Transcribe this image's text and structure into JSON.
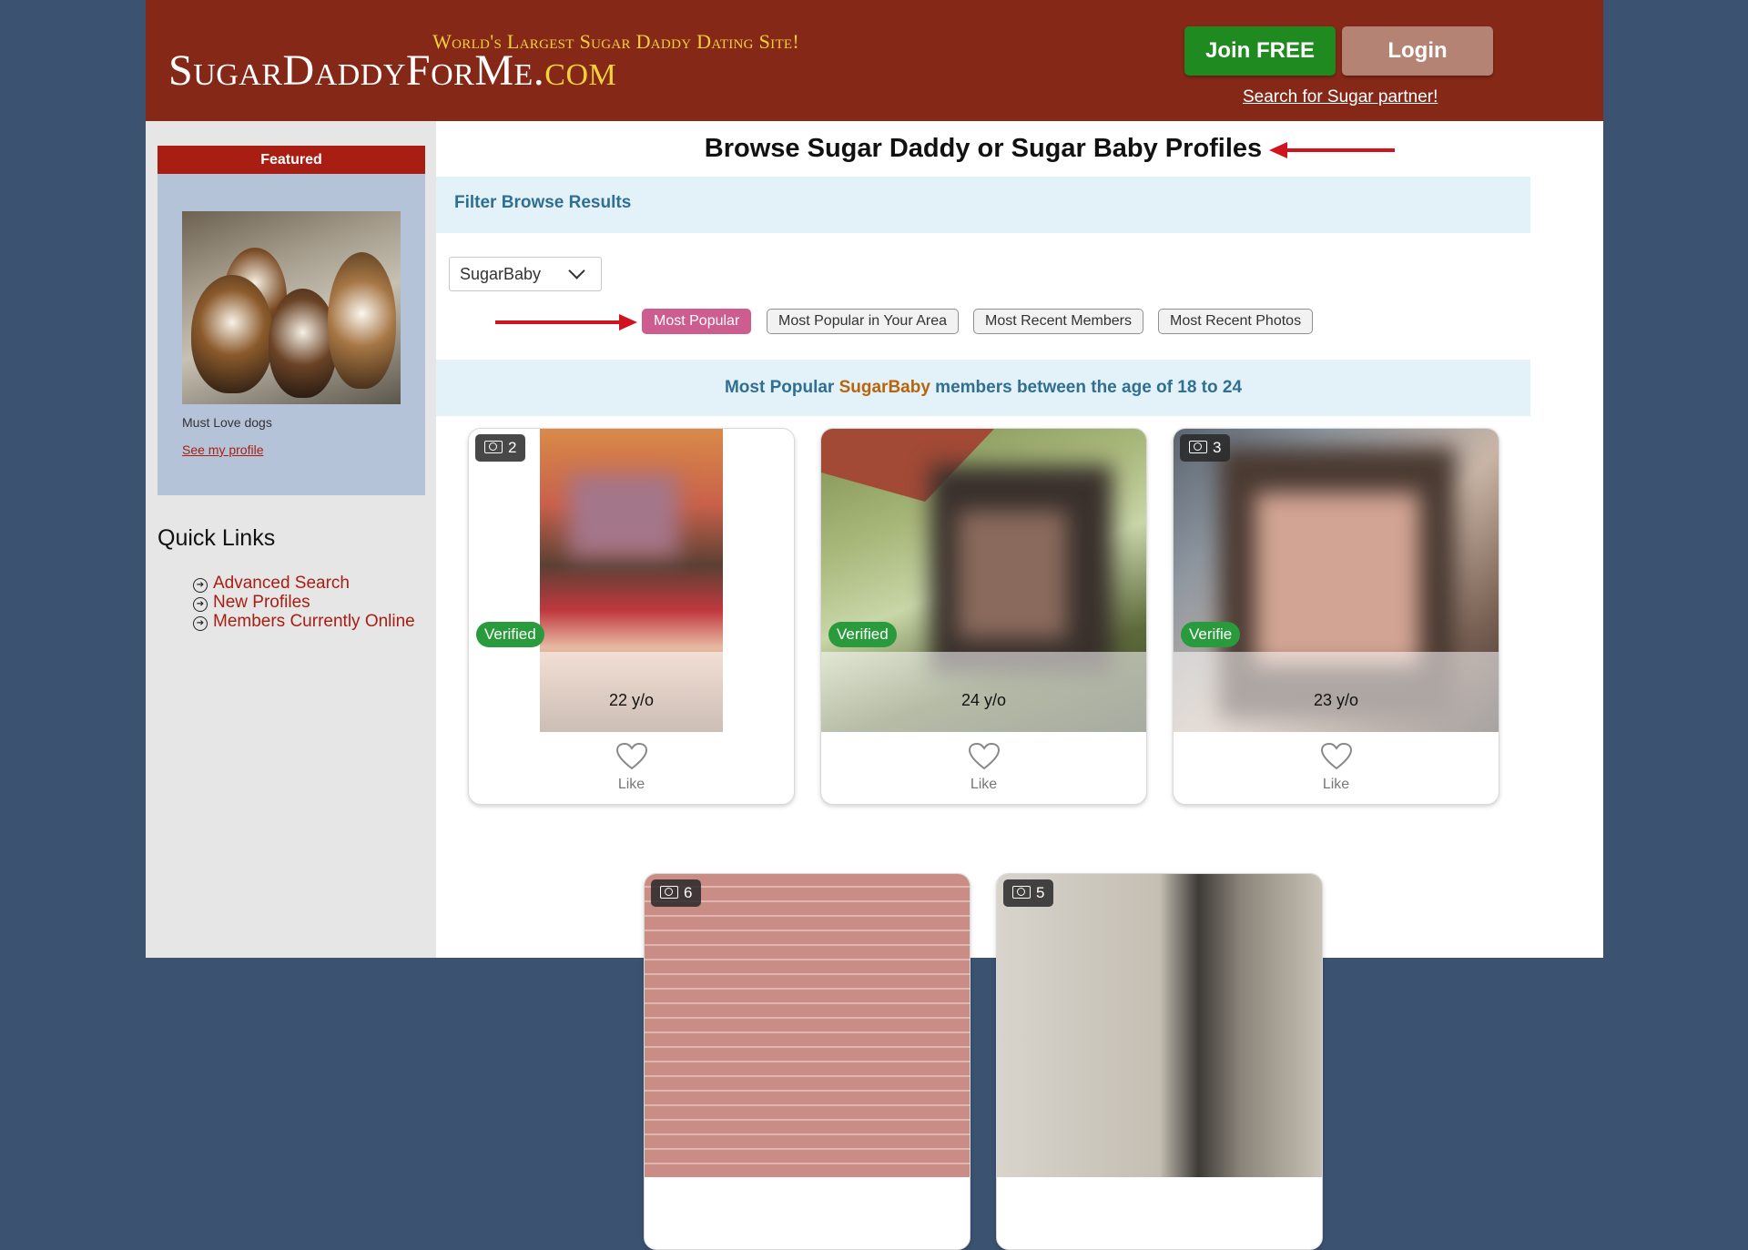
{
  "header": {
    "tagline": "World's Largest Sugar Daddy Dating Site!",
    "logo_main": "SugarDaddyForMe.",
    "logo_suffix": "com",
    "join_label": "Join FREE",
    "login_label": "Login",
    "search_link": "Search for Sugar partner!"
  },
  "sidebar": {
    "featured": {
      "heading": "Featured",
      "caption": "Must Love dogs",
      "link": "See my profile"
    },
    "quick_links": {
      "title": "Quick Links",
      "items": [
        {
          "label": "Advanced Search"
        },
        {
          "label": "New Profiles"
        },
        {
          "label": "Members Currently Online"
        }
      ]
    }
  },
  "main": {
    "title": "Browse Sugar Daddy or Sugar Baby Profiles",
    "filter_label": "Filter Browse Results",
    "member_type": "SugarBaby",
    "sort_tabs": [
      {
        "label": "Most Popular",
        "active": true
      },
      {
        "label": "Most Popular in Your Area",
        "active": false
      },
      {
        "label": "Most Recent Members",
        "active": false
      },
      {
        "label": "Most Recent Photos",
        "active": false
      }
    ],
    "results": {
      "prefix": "Most Popular ",
      "type": "SugarBaby",
      "suffix": " members between the age of 18 to 24"
    }
  },
  "cards": [
    {
      "photo_count": "2",
      "verified": "Verified",
      "age": "22 y/o",
      "like_label": "Like"
    },
    {
      "photo_count": "",
      "verified": "Verified",
      "age": "24 y/o",
      "like_label": "Like"
    },
    {
      "photo_count": "3",
      "verified": "Verifie",
      "age": "23 y/o",
      "like_label": "Like"
    },
    {
      "photo_count": "6"
    },
    {
      "photo_count": "5"
    }
  ],
  "colors": {
    "header_bg": "#862818",
    "accent_red": "#a91e12",
    "join_green": "#1f8a1f",
    "active_tab_pink": "#cc5d8e",
    "info_blue": "#2f6f92",
    "verified_green": "#2a9b3c"
  }
}
